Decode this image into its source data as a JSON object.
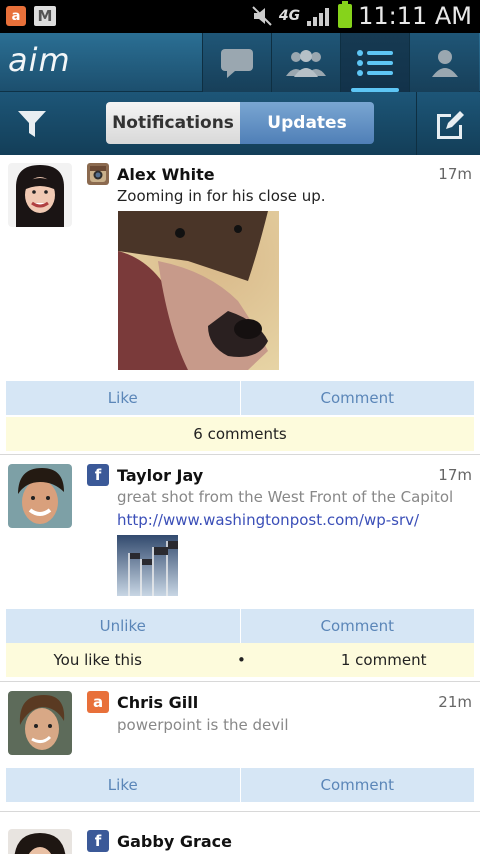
{
  "status_bar": {
    "app_icon_letter": "a",
    "network": "4G",
    "time": "11:11 AM"
  },
  "header": {
    "logo": "aim",
    "nav": [
      {
        "icon": "chat-icon"
      },
      {
        "icon": "buddies-icon"
      },
      {
        "icon": "list-icon",
        "active": true
      },
      {
        "icon": "profile-icon"
      }
    ]
  },
  "subheader": {
    "tabs": [
      {
        "label": "Notifications",
        "active": false
      },
      {
        "label": "Updates",
        "active": true
      }
    ]
  },
  "posts": [
    {
      "name": "Alex White",
      "service": "instagram",
      "time": "17m",
      "text": "Zooming in for his close up.",
      "like_label": "Like",
      "comment_label": "Comment",
      "meta": "6 comments"
    },
    {
      "name": "Taylor Jay",
      "service": "facebook",
      "time": "17m",
      "text": "great shot from the West Front of the Capitol",
      "link": "http://www.washingtonpost.com/wp-srv/",
      "like_label": "Unlike",
      "comment_label": "Comment",
      "meta_left": "You like this",
      "meta_sep": "•",
      "meta_right": "1 comment"
    },
    {
      "name": "Chris Gill",
      "service": "aim",
      "service_letter": "a",
      "time": "21m",
      "text": "powerpoint is the devil",
      "like_label": "Like",
      "comment_label": "Comment"
    },
    {
      "name": "Gabby Grace",
      "service": "facebook"
    }
  ],
  "colors": {
    "header_blue": "#1f5677",
    "active_tab": "#5b8bc0",
    "action_bar": "#d6e6f5",
    "meta_bar": "#fdfbdc",
    "aim_orange": "#e8703a",
    "facebook_blue": "#3b5998"
  }
}
